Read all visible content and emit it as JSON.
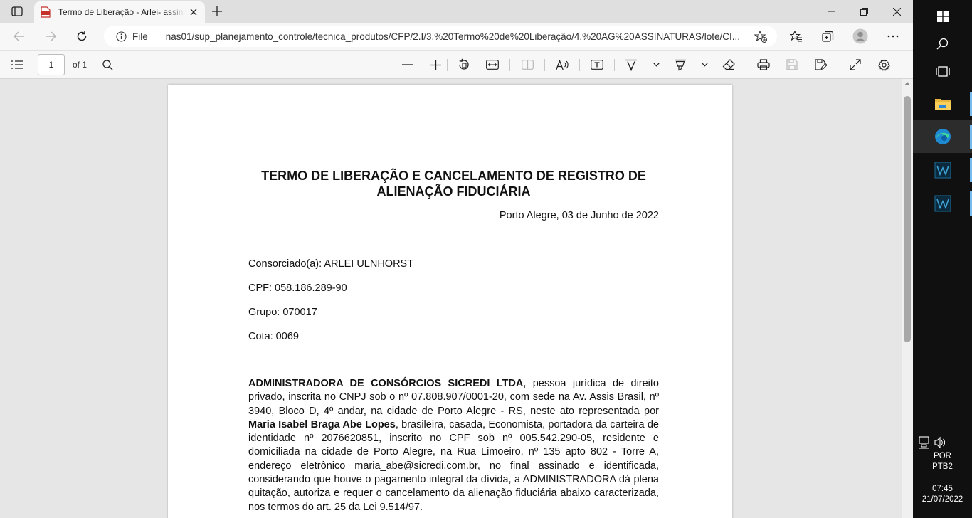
{
  "tab": {
    "title": "Termo de Liberação - Arlei- assinado.pdf"
  },
  "address": {
    "scheme_label": "File",
    "url": "nas01/sup_planejamento_controle/tecnica_produtos/CFP/2.I/3.%20Termo%20de%20Liberação/4.%20AG%20ASSINATURAS/lote/CI..."
  },
  "pdf_toolbar": {
    "page_current": "1",
    "page_total_label": "of 1"
  },
  "document": {
    "title_line1": "TERMO DE LIBERAÇÃO E CANCELAMENTO DE REGISTRO DE",
    "title_line2": "ALIENAÇÃO FIDUCIÁRIA",
    "date": "Porto Alegre, 03 de Junho de 2022",
    "consorciado": "Consorciado(a): ARLEI ULNHORST",
    "cpf": "CPF:  058.186.289-90",
    "grupo": "Grupo: 070017",
    "cota": "Cota: 0069",
    "admin_name": "ADMINISTRADORA DE CONSÓRCIOS SICREDI LTDA",
    "para_a": ", pessoa jurídica de direito privado, inscrita no CNPJ sob o nº 07.808.907/0001-20, com sede na Av. Assis Brasil, nº 3940, Bloco D, 4º andar, na cidade de Porto Alegre - RS, neste ato representada por ",
    "rep_name": "Maria Isabel Braga Abe Lopes",
    "para_b": ", brasileira, casada, Economista, portadora da carteira de identidade nº 2076620851, inscrito no CPF sob nº 005.542.290-05, residente e domiciliada na cidade de Porto Alegre, na Rua Limoeiro, nº 135 apto 802 - Torre A, endereço eletrônico maria_abe@sicredi.com.br, no final assinado e identificada, considerando que houve o pagamento integral da dívida, a ADMINISTRADORA dá plena quitação, autoriza e requer o cancelamento da alienação fiduciária abaixo caracterizada, nos termos do art. 25 da Lei 9.514/97."
  },
  "taskbar": {
    "lang_line1": "POR",
    "lang_line2": "PTB2",
    "time": "07:45",
    "date": "21/07/2022"
  },
  "icons": {
    "tab_actions": "tab-actions-icon",
    "pdf_favicon": "pdf-file-icon",
    "close": "close-icon",
    "new_tab": "plus-icon",
    "back": "back-arrow-icon",
    "forward": "forward-arrow-icon",
    "refresh": "refresh-icon",
    "info": "info-icon",
    "favorite_add": "star-add-icon",
    "favorites": "favorites-icon",
    "collections": "collections-icon",
    "profile": "profile-avatar-icon",
    "more": "more-icon",
    "contents": "contents-list-icon",
    "find": "search-icon",
    "zoom_out": "minus-icon",
    "zoom_in": "plus-icon",
    "rotate": "rotate-icon",
    "fit": "fit-width-icon",
    "page_view": "page-view-icon",
    "read_aloud": "read-aloud-icon",
    "text": "add-text-icon",
    "draw": "draw-icon",
    "highlight": "highlight-icon",
    "erase": "eraser-icon",
    "print": "print-icon",
    "save": "save-icon",
    "save_as": "save-as-icon",
    "fullscreen": "fullscreen-icon",
    "settings": "settings-gear-icon",
    "windows_start": "windows-start-icon",
    "taskbar_search": "search-icon",
    "task_view": "task-view-icon",
    "file_explorer": "file-explorer-icon",
    "edge": "edge-browser-icon",
    "app_w": "app-w-icon"
  },
  "colors": {
    "taskbar_bg": "#101010",
    "pin_accent": "#76b9ed",
    "pdf_red": "#c4312b",
    "edge_blue": "#1f8ad2"
  }
}
